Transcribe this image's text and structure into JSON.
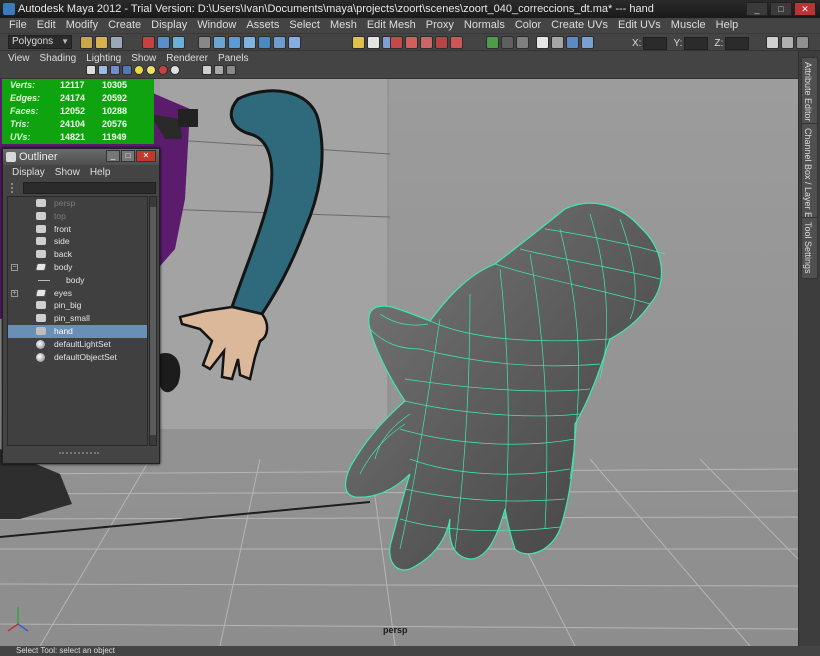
{
  "window": {
    "title": "Autodesk Maya 2012 - Trial Version: D:\\Users\\Ivan\\Documents\\maya\\projects\\zoort\\scenes\\zoort_040_correccions_dt.ma*   ---   hand",
    "minimize_label": "_",
    "maximize_label": "□",
    "close_label": "✕"
  },
  "menubar": {
    "items": [
      "File",
      "Edit",
      "Modify",
      "Create",
      "Display",
      "Window",
      "Assets",
      "Select",
      "Mesh",
      "Edit Mesh",
      "Proxy",
      "Normals",
      "Color",
      "Create UVs",
      "Edit UVs",
      "Muscle",
      "Help"
    ]
  },
  "toolbar": {
    "mode": "Polygons",
    "x_label": "X:",
    "y_label": "Y:",
    "z_label": "Z:"
  },
  "panel_menu": {
    "items": [
      "View",
      "Shading",
      "Lighting",
      "Show",
      "Renderer",
      "Panels"
    ]
  },
  "side_tabs": {
    "items": [
      "Attribute Editor",
      "Channel Box / Layer Editor",
      "Tool Settings"
    ]
  },
  "hud": {
    "rows": [
      {
        "label": "Verts:",
        "v1": "12117",
        "v2": "10305"
      },
      {
        "label": "Edges:",
        "v1": "24174",
        "v2": "20592"
      },
      {
        "label": "Faces:",
        "v1": "12052",
        "v2": "10288"
      },
      {
        "label": "Tris:",
        "v1": "24104",
        "v2": "20576"
      },
      {
        "label": "UVs:",
        "v1": "14821",
        "v2": "11949"
      }
    ]
  },
  "viewport": {
    "camera_label": "persp",
    "wire_color": "#3fe8b0",
    "background_color": "#9a9a9a"
  },
  "outliner": {
    "title": "Outliner",
    "menu": [
      "Display",
      "Show",
      "Help"
    ],
    "items": [
      {
        "label": "persp",
        "icon": "camera-icon",
        "dim": true
      },
      {
        "label": "top",
        "icon": "camera-icon",
        "dim": true
      },
      {
        "label": "front",
        "icon": "camera-icon"
      },
      {
        "label": "side",
        "icon": "camera-icon"
      },
      {
        "label": "back",
        "icon": "camera-icon"
      },
      {
        "label": "body",
        "icon": "mesh-icon",
        "expander": "−"
      },
      {
        "label": "body",
        "icon": "locator-icon",
        "indent": true
      },
      {
        "label": "eyes",
        "icon": "mesh-icon",
        "expander": "+"
      },
      {
        "label": "pin_big",
        "icon": "camera-icon"
      },
      {
        "label": "pin_small",
        "icon": "camera-icon"
      },
      {
        "label": "hand",
        "icon": "group-icon",
        "selected": true
      },
      {
        "label": "defaultLightSet",
        "icon": "set-icon"
      },
      {
        "label": "defaultObjectSet",
        "icon": "set-icon"
      }
    ]
  },
  "helpline": {
    "text": "Select Tool: select an object"
  }
}
